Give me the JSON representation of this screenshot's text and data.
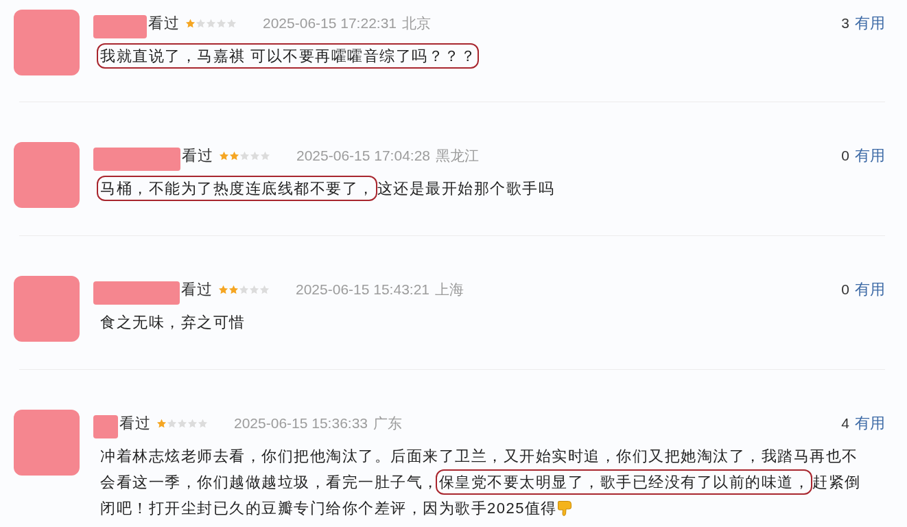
{
  "reviews": [
    {
      "status": "看过",
      "stars": 1,
      "time": "2025-06-15 17:22:31",
      "location": "北京",
      "useful_count": "3",
      "useful_label": "有用",
      "content": [
        {
          "kind": "text",
          "text": "我就直说了，马嘉祺 可以不要再嚯嚯音综了吗？？？",
          "circled": true
        }
      ]
    },
    {
      "status": "看过",
      "stars": 2,
      "time": "2025-06-15 17:04:28",
      "location": "黑龙江",
      "useful_count": "0",
      "useful_label": "有用",
      "content": [
        {
          "kind": "text",
          "text": "马桶，不能为了热度连底线都不要了，",
          "circled": true
        },
        {
          "kind": "text",
          "text": "这还是最开始那个歌手吗",
          "circled": false
        }
      ]
    },
    {
      "status": "看过",
      "stars": 2,
      "time": "2025-06-15 15:43:21",
      "location": "上海",
      "useful_count": "0",
      "useful_label": "有用",
      "content": [
        {
          "kind": "text",
          "text": "食之无味，弃之可惜",
          "circled": false
        }
      ]
    },
    {
      "status": "看过",
      "stars": 1,
      "time": "2025-06-15 15:36:33",
      "location": "广东",
      "useful_count": "4",
      "useful_label": "有用",
      "content": [
        {
          "kind": "text",
          "text": "冲着林志炫老师去看，你们把他淘汰了。后面来了卫兰，又开始实时追，你们又把她淘汰了，我踏马再也不会看这一季，你们越做越垃圾，看完一肚子气，",
          "circled": false
        },
        {
          "kind": "text",
          "text": "保皇党不要太明显了，歌手已经没有了以前的味道，",
          "circled": true
        },
        {
          "kind": "text",
          "text": "赶紧倒闭吧！打开尘封已久的豆瓣专门给你个差评，因为歌手2025值得",
          "circled": false
        },
        {
          "kind": "emoji"
        }
      ]
    }
  ]
}
